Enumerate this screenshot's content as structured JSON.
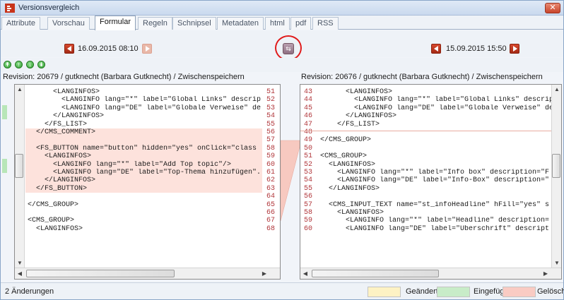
{
  "window": {
    "title": "Versionsvergleich",
    "close_glyph": "✕"
  },
  "tabs": [
    {
      "label": "Attribute",
      "active": false
    },
    {
      "label": "Vorschau",
      "active": false
    },
    {
      "label": "Formular",
      "active": true
    },
    {
      "label": "Regeln",
      "active": false
    },
    {
      "label": "Schnipsel",
      "active": false
    },
    {
      "label": "Metadaten",
      "active": false
    },
    {
      "label": "html",
      "active": false
    },
    {
      "label": "pdf",
      "active": false
    },
    {
      "label": "RSS",
      "active": false
    }
  ],
  "toolbar": {
    "left_date": "16.09.2015 08:10",
    "right_date": "15.09.2015 15:50",
    "swap_icon": "swap-icon"
  },
  "stepper": {
    "glyphs": [
      "↟",
      "↑",
      "↓",
      "↡"
    ]
  },
  "left": {
    "revision": "Revision: 20679 / gutknecht (Barbara Gutknecht) / Zwischenspeichern",
    "lines": [
      {
        "num": "51",
        "text": "      <LANGINFOS>",
        "state": "normal"
      },
      {
        "num": "52",
        "text": "        <LANGINFO lang=\"*\" label=\"Global Links\" descrip",
        "state": "normal"
      },
      {
        "num": "53",
        "text": "        <LANGINFO lang=\"DE\" label=\"Globale Verweise\" de",
        "state": "normal"
      },
      {
        "num": "54",
        "text": "      </LANGINFOS>",
        "state": "normal"
      },
      {
        "num": "55",
        "text": "    </FS_LIST>",
        "state": "normal"
      },
      {
        "num": "56",
        "text": "  </CMS_COMMENT>",
        "state": "deleted"
      },
      {
        "num": "57",
        "text": "",
        "state": "deleted"
      },
      {
        "num": "58",
        "text": "  <FS_BUTTON name=\"button\" hidden=\"yes\" onClick=\"class",
        "state": "deleted"
      },
      {
        "num": "59",
        "text": "    <LANGINFOS>",
        "state": "deleted"
      },
      {
        "num": "60",
        "text": "      <LANGINFO lang=\"*\" label=\"Add Top topic\"/>",
        "state": "deleted"
      },
      {
        "num": "61",
        "text": "      <LANGINFO lang=\"DE\" label=\"Top-Thema hinzufügen\".",
        "state": "deleted"
      },
      {
        "num": "62",
        "text": "    </LANGINFOS>",
        "state": "deleted"
      },
      {
        "num": "63",
        "text": "  </FS_BUTTON>",
        "state": "deleted"
      },
      {
        "num": "64",
        "text": "",
        "state": "normal"
      },
      {
        "num": "65",
        "text": "</CMS_GROUP>",
        "state": "normal"
      },
      {
        "num": "66",
        "text": "",
        "state": "normal"
      },
      {
        "num": "67",
        "text": "<CMS_GROUP>",
        "state": "normal"
      },
      {
        "num": "68",
        "text": "  <LANGINFOS>",
        "state": "normal"
      }
    ]
  },
  "right": {
    "revision": "Revision: 20676 / gutknecht (Barbara Gutknecht) / Zwischenspeichern",
    "lines": [
      {
        "num": "43",
        "text": "      <LANGINFOS>"
      },
      {
        "num": "44",
        "text": "        <LANGINFO lang=\"*\" label=\"Global Links\" descript"
      },
      {
        "num": "45",
        "text": "        <LANGINFO lang=\"DE\" label=\"Globale Verweise\" des"
      },
      {
        "num": "46",
        "text": "      </LANGINFOS>"
      },
      {
        "num": "47",
        "text": "    </FS_LIST>"
      },
      {
        "num": "48",
        "text": ""
      },
      {
        "num": "49",
        "text": "</CMS_GROUP>"
      },
      {
        "num": "50",
        "text": ""
      },
      {
        "num": "51",
        "text": "<CMS_GROUP>"
      },
      {
        "num": "52",
        "text": "  <LANGINFOS>"
      },
      {
        "num": "53",
        "text": "    <LANGINFO lang=\"*\" label=\"Info box\" description=\"F"
      },
      {
        "num": "54",
        "text": "    <LANGINFO lang=\"DE\" label=\"Info-Box\" description=\""
      },
      {
        "num": "55",
        "text": "  </LANGINFOS>"
      },
      {
        "num": "56",
        "text": ""
      },
      {
        "num": "57",
        "text": "  <CMS_INPUT_TEXT name=\"st_infoHeadline\" hFill=\"yes\" s"
      },
      {
        "num": "58",
        "text": "    <LANGINFOS>"
      },
      {
        "num": "59",
        "text": "      <LANGINFO lang=\"*\" label=\"Headline\" description="
      },
      {
        "num": "60",
        "text": "      <LANGINFO lang=\"DE\" label=\"Überschrift\" descript"
      }
    ]
  },
  "status": {
    "changes": "2 Änderungen",
    "legend": [
      {
        "label": "Geändert",
        "color": "#fdf2c4"
      },
      {
        "label": "Eingefügt",
        "color": "#c8ecc8"
      },
      {
        "label": "Gelöscht",
        "color": "#f9cbc3"
      }
    ]
  },
  "colors": {
    "deleted_bg": "#fde2dc",
    "accent_red": "#c8341a",
    "line_number": "#b0363a"
  }
}
